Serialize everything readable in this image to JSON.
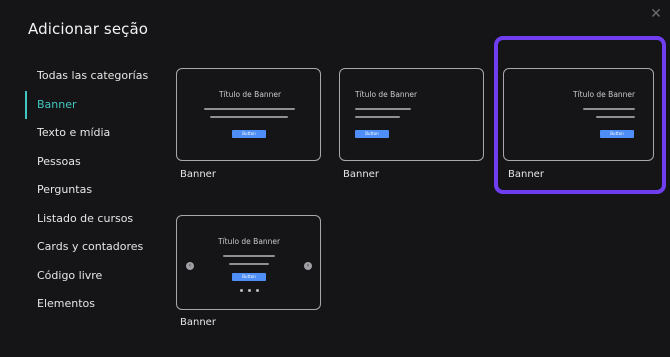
{
  "modal": {
    "title": "Adicionar seção",
    "close_icon": "close-icon"
  },
  "sidebar": {
    "items": [
      {
        "label": "Todas las categorías"
      },
      {
        "label": "Banner"
      },
      {
        "label": "Texto e mídia"
      },
      {
        "label": "Pessoas"
      },
      {
        "label": "Perguntas"
      },
      {
        "label": "Listado de cursos"
      },
      {
        "label": "Cards y contadores"
      },
      {
        "label": "Código livre"
      },
      {
        "label": "Elementos"
      }
    ],
    "active_index": 1
  },
  "templates": [
    {
      "caption": "Banner",
      "preview_title": "Título de Banner",
      "button_label": "Button",
      "align": "center"
    },
    {
      "caption": "Banner",
      "preview_title": "Título de Banner",
      "button_label": "Button",
      "align": "left"
    },
    {
      "caption": "Banner",
      "preview_title": "Título de Banner",
      "button_label": "Button",
      "align": "right",
      "selected": true
    },
    {
      "caption": "Banner",
      "preview_title": "Título de Banner",
      "button_label": "Button",
      "align": "carousel"
    }
  ],
  "colors": {
    "accent_active": "#40c7c1",
    "selection": "#6e3ef0",
    "button": "#4f8ef7",
    "background": "#151517"
  }
}
